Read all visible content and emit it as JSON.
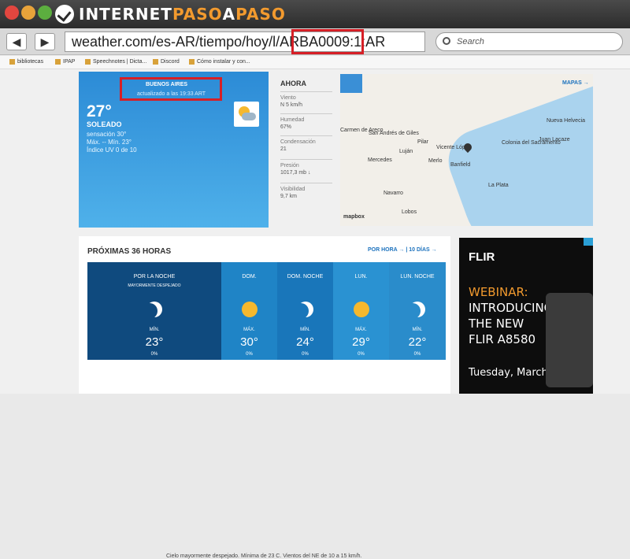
{
  "site": {
    "logo_a": "INTERNET",
    "logo_b": "PASO",
    "logo_c": "A",
    "logo_d": "PASO"
  },
  "browser": {
    "back": "◀",
    "forward": "▶",
    "url": "weather.com/es-AR/tiempo/hoy/l/ARBA0009:1:AR",
    "search_placeholder": "Search",
    "bookmarks": [
      "bibliotecas",
      "IPAP",
      "Speechnotes | Dicta...",
      "Discord",
      "Cómo instalar y con..."
    ]
  },
  "current": {
    "city": "BUENOS AIRES",
    "updated": "actualizado a las 19:33 ART",
    "temp": "27°",
    "condition": "SOLEADO",
    "feels": "sensación 30°",
    "maxmin": "Máx. -- Mín. 23°",
    "uv": "Índice UV 0 de 10"
  },
  "now": {
    "heading": "AHORA",
    "stats": [
      {
        "label": "Viento",
        "value": "N 5 km/h"
      },
      {
        "label": "Humedad",
        "value": "67%"
      },
      {
        "label": "Condensación",
        "value": "21"
      },
      {
        "label": "Presión",
        "value": "1017,3 mb ↓"
      },
      {
        "label": "Visibilidad",
        "value": "9,7 km"
      }
    ]
  },
  "map": {
    "link": "MAPAS →",
    "brand": "mapbox",
    "places": [
      {
        "name": "Nueva Helvecia"
      },
      {
        "name": "Colonia del Sacramento"
      },
      {
        "name": "Juan Lacaze"
      },
      {
        "name": "San Andrés de Giles"
      },
      {
        "name": "Carmen de Areco"
      },
      {
        "name": "Pilar"
      },
      {
        "name": "Vicente López"
      },
      {
        "name": "Luján"
      },
      {
        "name": "Mercedes"
      },
      {
        "name": "Merlo"
      },
      {
        "name": "Banfield"
      },
      {
        "name": "La Plata"
      },
      {
        "name": "Navarro"
      },
      {
        "name": "Lobos"
      }
    ]
  },
  "forecast": {
    "title": "PRÓXIMAS 36 HORAS",
    "links": "POR HORA → | 10 DÍAS →",
    "min_label": "MÍN.",
    "max_label": "MÁX.",
    "periods": [
      {
        "label": "POR LA NOCHE",
        "sub": "MAYORMENTE DESPEJADO",
        "kind": "MÍN.",
        "temp": "23°",
        "precip": "0%",
        "icon": "moon-icon",
        "color": "#0f4a7e"
      },
      {
        "label": "DOM.",
        "sub": "",
        "kind": "MÁX.",
        "temp": "30°",
        "precip": "0%",
        "icon": "sun-icon",
        "color": "#1f84c6"
      },
      {
        "label": "DOM. NOCHE",
        "sub": "",
        "kind": "MÍN.",
        "temp": "24°",
        "precip": "0%",
        "icon": "moon-icon",
        "color": "#1976ba"
      },
      {
        "label": "LUN.",
        "sub": "",
        "kind": "MÁX.",
        "temp": "29°",
        "precip": "0%",
        "icon": "sun-icon",
        "color": "#2a92d2"
      },
      {
        "label": "LUN. NOCHE",
        "sub": "",
        "kind": "MÍN.",
        "temp": "22°",
        "precip": "0%",
        "icon": "moon-icon",
        "color": "#2a8ccb"
      }
    ],
    "footnote": "Cielo mayormente despejado. Mínima de 23 C. Vientos del NE de 10 a 15 km/h."
  },
  "ad": {
    "brand": "FLIR",
    "webinar": "WEBINAR:",
    "lines": [
      "INTRODUCING",
      "THE NEW",
      "FLIR A8580"
    ],
    "date": "Tuesday, March 3rd"
  }
}
